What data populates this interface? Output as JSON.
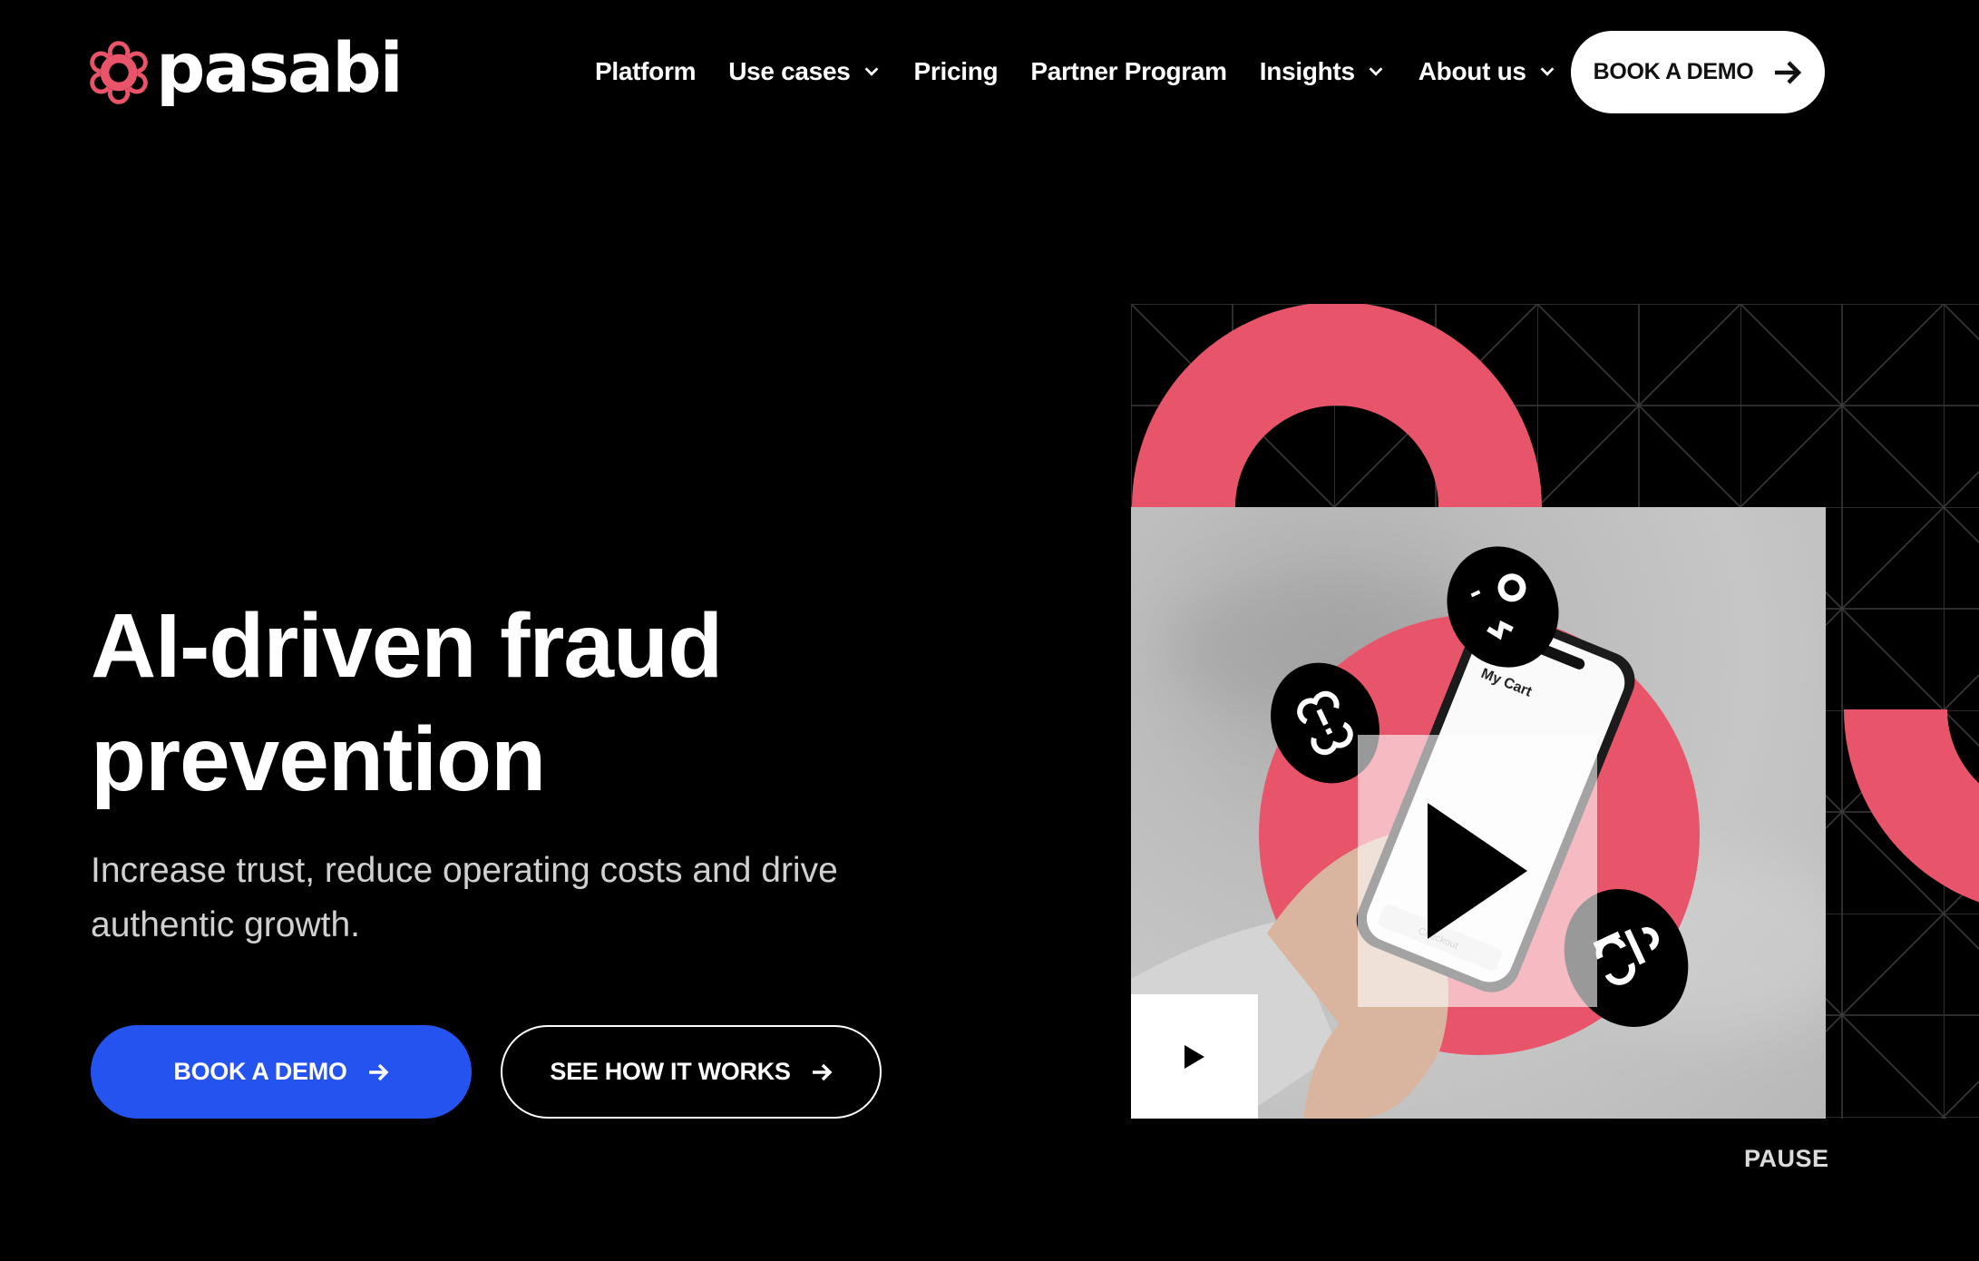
{
  "brand": {
    "name": "pasabi",
    "logo_icon": "flower-logo-icon",
    "accent_color": "#E8546A"
  },
  "nav": {
    "items": [
      {
        "label": "Platform",
        "has_dropdown": false
      },
      {
        "label": "Use cases",
        "has_dropdown": true
      },
      {
        "label": "Pricing",
        "has_dropdown": false
      },
      {
        "label": "Partner Program",
        "has_dropdown": false
      },
      {
        "label": "Insights",
        "has_dropdown": true
      },
      {
        "label": "About us",
        "has_dropdown": true
      }
    ],
    "cta_label": "BOOK A DEMO"
  },
  "hero": {
    "headline_line1": "AI-driven fraud",
    "headline_line2": "prevention",
    "subtitle": "Increase trust, reduce operating costs and drive authentic growth.",
    "primary_button": "BOOK A DEMO",
    "secondary_button": "SEE HOW IT WORKS",
    "primary_color": "#2453F0"
  },
  "media": {
    "phone_screen_title": "My Cart",
    "phone_checkout_label": "Checkout",
    "pause_label": "PAUSE",
    "icons": [
      "play-icon",
      "small-play-icon",
      "alert-badge-icon",
      "face-badge-icon",
      "scan-badge-icon"
    ]
  }
}
